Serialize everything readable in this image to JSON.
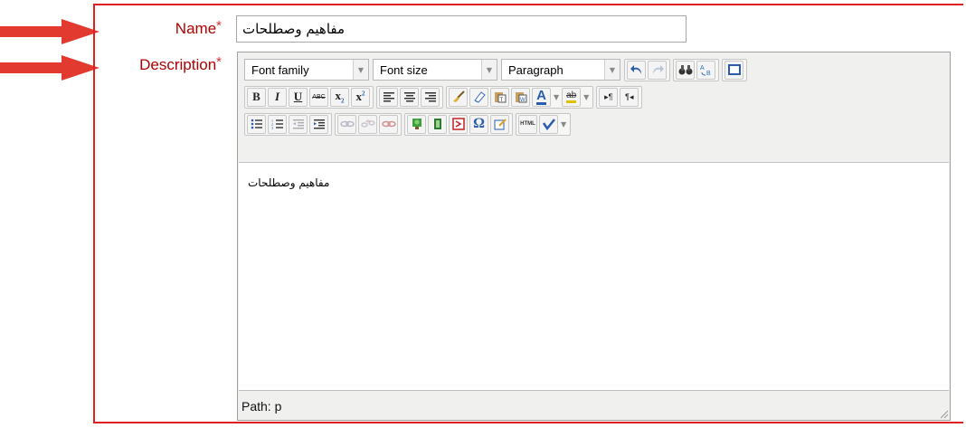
{
  "form": {
    "name_label": "Name",
    "description_label": "Description",
    "required_mark": "*",
    "name_value": "مفاهيم وصطلحات"
  },
  "editor": {
    "font_family": "Font family",
    "font_size": "Font size",
    "block_format": "Paragraph",
    "bold": "B",
    "italic": "I",
    "underline": "U",
    "strike": "ABC",
    "subscript": "x",
    "superscript": "x",
    "content_text": "مفاهيم وصطلحات",
    "path_label": "Path: p",
    "text_color_glyph": "A",
    "highlight_glyph": "ab",
    "html_label": "HTML",
    "omega": "Ω",
    "ltr": "▸¶",
    "rtl": "¶◂"
  },
  "colors": {
    "frame": "#e02020",
    "label": "#b00000",
    "arrow": "#e33a2f"
  }
}
